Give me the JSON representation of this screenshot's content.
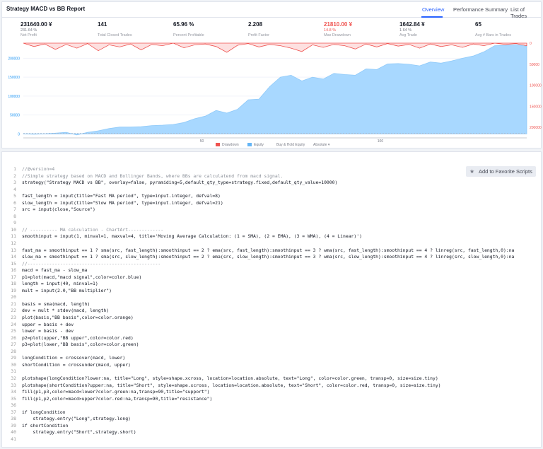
{
  "header": {
    "title": "Strategy MACD vs BB Report",
    "tabs": [
      "Overview",
      "Performance Summary",
      "List of Trades"
    ],
    "active_tab": "Overview"
  },
  "stats": [
    {
      "value": "231640.00 ¥",
      "sub": "231.64 %",
      "label": "Net Profit",
      "red": false
    },
    {
      "value": "141",
      "sub": "",
      "label": "Total Closed Trades",
      "red": false
    },
    {
      "value": "65.96 %",
      "sub": "",
      "label": "Percent Profitable",
      "red": false
    },
    {
      "value": "2.208",
      "sub": "",
      "label": "Profit Factor",
      "red": false
    },
    {
      "value": "21810.00 ¥",
      "sub": "14.8 %",
      "label": "Max Drawdown",
      "red": true
    },
    {
      "value": "1642.84 ¥",
      "sub": "1.64 %",
      "label": "Avg Trade",
      "red": false
    },
    {
      "value": "65",
      "sub": "",
      "label": "Avg # Bars in Trades",
      "red": false
    }
  ],
  "chart_data": {
    "type": "area",
    "series": [
      {
        "name": "Equity",
        "color": "#a8d8ff",
        "x": [
          0,
          3,
          6,
          9,
          12,
          15,
          18,
          21,
          24,
          27,
          30,
          33,
          36,
          39,
          42,
          45,
          48,
          51,
          54,
          57,
          60,
          63,
          66,
          69,
          72,
          75,
          78,
          81,
          84,
          87,
          90,
          93,
          96,
          99,
          102,
          105,
          108,
          111,
          114,
          117,
          120,
          123,
          126,
          129,
          132,
          135,
          138,
          141
        ],
        "y": [
          0,
          -1000,
          0,
          2000,
          4000,
          -3000,
          4000,
          8000,
          14000,
          18000,
          18000,
          19000,
          22000,
          23000,
          25000,
          30000,
          40000,
          47000,
          62000,
          55000,
          65000,
          90000,
          92000,
          125000,
          150000,
          155000,
          140000,
          150000,
          145000,
          160000,
          157000,
          155000,
          172000,
          170000,
          185000,
          186000,
          184000,
          180000,
          190000,
          187000,
          193000,
          200000,
          206000,
          217000,
          233000,
          234000,
          236000,
          232000
        ]
      },
      {
        "name": "Drawdown",
        "color": "#ef9a9a",
        "x": [
          0,
          3,
          6,
          9,
          12,
          15,
          18,
          21,
          24,
          27,
          30,
          33,
          36,
          39,
          42,
          45,
          48,
          51,
          54,
          57,
          60,
          63,
          66,
          69,
          72,
          75,
          78,
          81,
          84,
          87,
          90,
          93,
          96,
          99,
          102,
          105,
          108,
          111,
          114,
          117,
          120,
          123,
          126,
          129,
          132,
          135,
          138,
          141
        ],
        "y": [
          0,
          -8000,
          -2000,
          -15000,
          -3000,
          -12000,
          -1000,
          -18000,
          -4000,
          -9000,
          -2000,
          -16000,
          -3000,
          -6000,
          0,
          -11000,
          -4000,
          -2000,
          -8000,
          -21810,
          -5000,
          -1000,
          -9000,
          -3000,
          -6000,
          -12000,
          -20000,
          -4000,
          -10000,
          -3000,
          -6000,
          -14000,
          -2000,
          -9000,
          -1000,
          -7000,
          -3000,
          -12000,
          -2000,
          -8000,
          -4000,
          -10000,
          -2000,
          -6000,
          0,
          -3000,
          -1000,
          -6000
        ]
      }
    ],
    "legend": [
      "Drawdown",
      "Equity",
      "Buy & Hold Equity"
    ],
    "legend_select": "Absolute",
    "x_ticks": [
      50,
      100
    ],
    "left_axis_ticks": [
      0,
      50000,
      100000,
      150000,
      200000
    ],
    "right_axis_ticks": [
      0,
      50000,
      100000,
      150000,
      200000
    ],
    "left_ylim": [
      -5000,
      240000
    ],
    "right_ylim": [
      0,
      220000
    ]
  },
  "code": {
    "fav_label": "Add to Favorite Scripts",
    "lines": [
      "//@version=4",
      "//Simple strategy based on MACD and Bollinger Bands, where BBs are calculatend from macd signal.",
      "strategy(\"Strategy MACD vs BB\", overlay=false, pyramiding=5,default_qty_type=strategy.fixed,default_qty_value=10000)",
      "",
      "fast_length = input(title=\"Fast MA period\", type=input.integer, defval=8)",
      "slow_length = input(title=\"Slow MA period\", type=input.integer, defval=21)",
      "src = input(close,\"Source\")",
      "",
      "",
      "// ---------- MA calculation - ChartArt-------------",
      "smoothinput = input(1, minval=1, maxval=4, title='Moving Average Calculation: (1 = SMA), (2 = EMA), (3 = WMA), (4 = Linear)')",
      "",
      "fast_ma = smoothinput == 1 ? sma(src, fast_length):smoothinput == 2 ? ema(src, fast_length):smoothinput == 3 ? wma(src, fast_length):smoothinput == 4 ? linreg(src, fast_length,0):na",
      "slow_ma = smoothinput == 1 ? sma(src, slow_length):smoothinput == 2 ? ema(src, slow_length):smoothinput == 3 ? wma(src, slow_length):smoothinput == 4 ? linreg(src, slow_length,0):na",
      "//-------------------------------------------------",
      "macd = fast_ma - slow_ma",
      "p1=plot(macd,\"macd signal\",color=color.blue)",
      "length = input(40, minval=1)",
      "mult = input(2.0,\"BB multiplier\")",
      "",
      "basis = sma(macd, length)",
      "dev = mult * stdev(macd, length)",
      "plot(basis,\"BB basis\",color=color.orange)",
      "upper = basis + dev",
      "lower = basis - dev",
      "p2=plot(upper,\"BB upper\",color=color.red)",
      "p3=plot(lower,\"BB basis\",color=color.green)",
      "",
      "longCondition = crossover(macd, lower)",
      "shortCondition = crossunder(macd, upper)",
      "",
      "plotshape(longCondition?lower:na, title=\"Long\", style=shape.xcross, location=location.absolute, text=\"Long\", color=color.green, transp=0, size=size.tiny)",
      "plotshape(shortCondition?upper:na, title=\"Short\", style=shape.xcross, location=location.absolute, text=\"Short\", color=color.red, transp=0, size=size.tiny)",
      "fill(p1,p3,color=macd<lower?color.green:na,transp=90,title=\"support\")",
      "fill(p1,p2,color=macd>upper?color.red:na,transp=90,title=\"resistance\")",
      "",
      "if longCondition",
      "    strategy.entry(\"Long\",strategy.long)",
      "if shortCondition",
      "    strategy.entry(\"Short\",strategy.short)",
      ""
    ]
  }
}
